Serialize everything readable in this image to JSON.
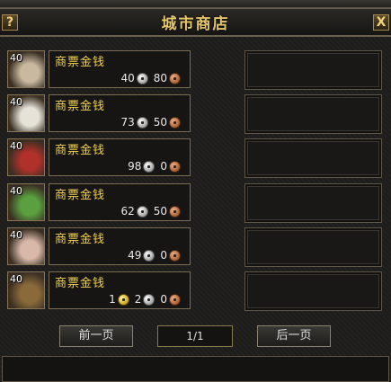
{
  "window": {
    "title": "城市商店",
    "help_label": "?",
    "close_label": "X"
  },
  "items": [
    {
      "qty": "40",
      "name": "商票金钱",
      "gold": null,
      "silver": "40",
      "copper": "80",
      "icon": "white-powder-icon",
      "color": "#c9b9a0"
    },
    {
      "qty": "40",
      "name": "商票金钱",
      "gold": null,
      "silver": "73",
      "copper": "50",
      "icon": "white-cloth-icon",
      "color": "#e6e2d8"
    },
    {
      "qty": "40",
      "name": "商票金钱",
      "gold": null,
      "silver": "98",
      "copper": "0",
      "icon": "red-berries-icon",
      "color": "#b0302a"
    },
    {
      "qty": "40",
      "name": "商票金钱",
      "gold": null,
      "silver": "62",
      "copper": "50",
      "icon": "green-herb-icon",
      "color": "#5aa040"
    },
    {
      "qty": "40",
      "name": "商票金钱",
      "gold": null,
      "silver": "49",
      "copper": "0",
      "icon": "silk-cloth-icon",
      "color": "#d8b8a8"
    },
    {
      "qty": "40",
      "name": "商票金钱",
      "gold": "1",
      "silver": "2",
      "copper": "0",
      "icon": "ornate-scroll-icon",
      "color": "#8a6a3a"
    }
  ],
  "pagination": {
    "prev_label": "前一页",
    "page_indicator": "1/1",
    "next_label": "后一页"
  }
}
